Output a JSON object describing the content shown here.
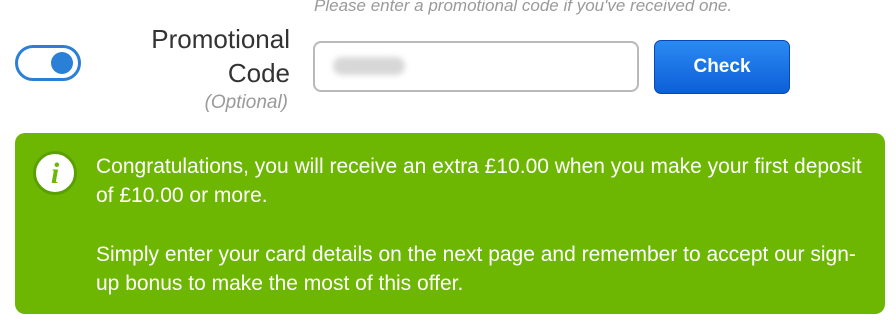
{
  "promo": {
    "hint": "Please enter a promotional code if you've received one.",
    "label": "Promotional Code",
    "optional": "(Optional)",
    "input_value": "",
    "check_label": "Check",
    "toggle_state": "on"
  },
  "notice": {
    "icon": "info-icon",
    "paragraph1": "Congratulations, you will receive an extra £10.00 when you make your first deposit of £10.00 or more.",
    "paragraph2": "Simply enter your card details on the next page and remember to accept our sign-up bonus to make the most of this offer."
  },
  "colors": {
    "accent_blue": "#2a7fd6",
    "notice_green": "#6db703",
    "button_blue": "#0c5fd8"
  }
}
